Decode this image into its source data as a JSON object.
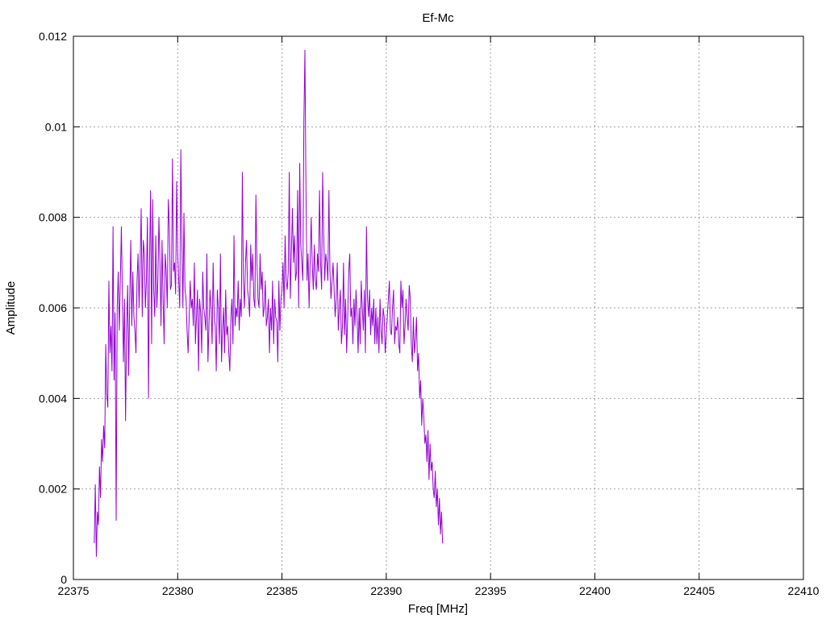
{
  "chart_data": {
    "type": "line",
    "title": "Ef-Mc",
    "xlabel": "Freq [MHz]",
    "ylabel": "Amplitude",
    "xlim": [
      22375,
      22410
    ],
    "ylim": [
      0,
      0.012
    ],
    "x_ticks": [
      22375,
      22380,
      22385,
      22390,
      22395,
      22400,
      22405,
      22410
    ],
    "x_tick_labels": [
      "22375",
      "22380",
      "22385",
      "22390",
      "22395",
      "22400",
      "22405",
      "22410"
    ],
    "y_ticks": [
      0,
      0.002,
      0.004,
      0.006,
      0.008,
      0.01,
      0.012
    ],
    "y_tick_labels": [
      "0",
      "0.002",
      "0.004",
      "0.006",
      "0.008",
      "0.01",
      "0.012"
    ],
    "grid": true,
    "series": [
      {
        "color": "#9400d3",
        "x_start": 22376.0,
        "x_step": 0.05,
        "values": [
          0.0008,
          0.0021,
          0.0005,
          0.0015,
          0.0012,
          0.0025,
          0.0018,
          0.0031,
          0.0026,
          0.0034,
          0.0029,
          0.0052,
          0.0041,
          0.0038,
          0.0066,
          0.005,
          0.0056,
          0.0046,
          0.0078,
          0.0044,
          0.0059,
          0.0013,
          0.006,
          0.0068,
          0.0055,
          0.0066,
          0.0078,
          0.0062,
          0.0048,
          0.0062,
          0.0035,
          0.0055,
          0.0065,
          0.0045,
          0.0062,
          0.0075,
          0.0056,
          0.0068,
          0.0058,
          0.0055,
          0.005,
          0.0066,
          0.0072,
          0.006,
          0.007,
          0.0082,
          0.0058,
          0.0075,
          0.0072,
          0.006,
          0.0066,
          0.008,
          0.004,
          0.007,
          0.0086,
          0.0052,
          0.0084,
          0.0064,
          0.0058,
          0.0076,
          0.006,
          0.0066,
          0.008,
          0.007,
          0.0056,
          0.0075,
          0.0062,
          0.0052,
          0.0072,
          0.0068,
          0.006,
          0.0084,
          0.0078,
          0.0064,
          0.0065,
          0.0093,
          0.0068,
          0.007,
          0.0063,
          0.0088,
          0.0072,
          0.0066,
          0.006,
          0.0095,
          0.0075,
          0.006,
          0.0081,
          0.0064,
          0.0062,
          0.0055,
          0.005,
          0.0058,
          0.0066,
          0.006,
          0.0062,
          0.0056,
          0.007,
          0.0052,
          0.0058,
          0.0064,
          0.0046,
          0.0062,
          0.0059,
          0.005,
          0.0068,
          0.006,
          0.0058,
          0.0055,
          0.0072,
          0.0048,
          0.0056,
          0.0064,
          0.006,
          0.0052,
          0.007,
          0.0058,
          0.0056,
          0.0046,
          0.0064,
          0.006,
          0.0052,
          0.0072,
          0.0048,
          0.0055,
          0.006,
          0.005,
          0.0064,
          0.0054,
          0.0056,
          0.005,
          0.0046,
          0.0058,
          0.0062,
          0.0052,
          0.0076,
          0.0056,
          0.006,
          0.0058,
          0.0066,
          0.0055,
          0.0062,
          0.0058,
          0.009,
          0.0066,
          0.006,
          0.007,
          0.0075,
          0.0064,
          0.0062,
          0.0058,
          0.0074,
          0.0066,
          0.0072,
          0.0062,
          0.006,
          0.0085,
          0.007,
          0.0062,
          0.006,
          0.0072,
          0.0064,
          0.0068,
          0.0058,
          0.006,
          0.0066,
          0.0056,
          0.0058,
          0.0062,
          0.005,
          0.006,
          0.0055,
          0.0066,
          0.0052,
          0.0062,
          0.0058,
          0.0057,
          0.0048,
          0.0066,
          0.0055,
          0.0062,
          0.0064,
          0.007,
          0.006,
          0.0076,
          0.0066,
          0.0064,
          0.0068,
          0.009,
          0.0062,
          0.0072,
          0.0082,
          0.007,
          0.0076,
          0.0066,
          0.0068,
          0.0086,
          0.006,
          0.0092,
          0.0074,
          0.007,
          0.0066,
          0.0101,
          0.0117,
          0.0086,
          0.0066,
          0.0072,
          0.006,
          0.007,
          0.008,
          0.007,
          0.0064,
          0.0074,
          0.0066,
          0.0064,
          0.0072,
          0.0068,
          0.0086,
          0.007,
          0.0064,
          0.009,
          0.0076,
          0.0066,
          0.0072,
          0.007,
          0.0066,
          0.0086,
          0.0068,
          0.0062,
          0.0066,
          0.007,
          0.0064,
          0.0058,
          0.0062,
          0.007,
          0.0055,
          0.006,
          0.0064,
          0.0052,
          0.0056,
          0.007,
          0.0054,
          0.0062,
          0.005,
          0.0058,
          0.0068,
          0.0072,
          0.0058,
          0.006,
          0.0052,
          0.0062,
          0.0056,
          0.0064,
          0.0058,
          0.005,
          0.006,
          0.0052,
          0.0066,
          0.006,
          0.0055,
          0.0064,
          0.005,
          0.0078,
          0.0062,
          0.0058,
          0.0064,
          0.0054,
          0.006,
          0.0056,
          0.0062,
          0.0052,
          0.006,
          0.0052,
          0.0058,
          0.005,
          0.0062,
          0.0055,
          0.0052,
          0.006,
          0.0058,
          0.005,
          0.0054,
          0.0058,
          0.0062,
          0.0066,
          0.0055,
          0.0054,
          0.006,
          0.0064,
          0.0052,
          0.0056,
          0.0055,
          0.0058,
          0.0052,
          0.005,
          0.0066,
          0.006,
          0.0064,
          0.0052,
          0.0056,
          0.0062,
          0.0058,
          0.0055,
          0.0065,
          0.0062,
          0.0052,
          0.0048,
          0.0058,
          0.005,
          0.0053,
          0.0058,
          0.0046,
          0.005,
          0.004,
          0.0044,
          0.0034,
          0.004,
          0.0036,
          0.003,
          0.0032,
          0.0026,
          0.0033,
          0.0022,
          0.003,
          0.0024,
          0.0026,
          0.002,
          0.0018,
          0.0024,
          0.0016,
          0.002,
          0.0012,
          0.0018,
          0.001,
          0.0015,
          0.0008
        ]
      }
    ]
  }
}
